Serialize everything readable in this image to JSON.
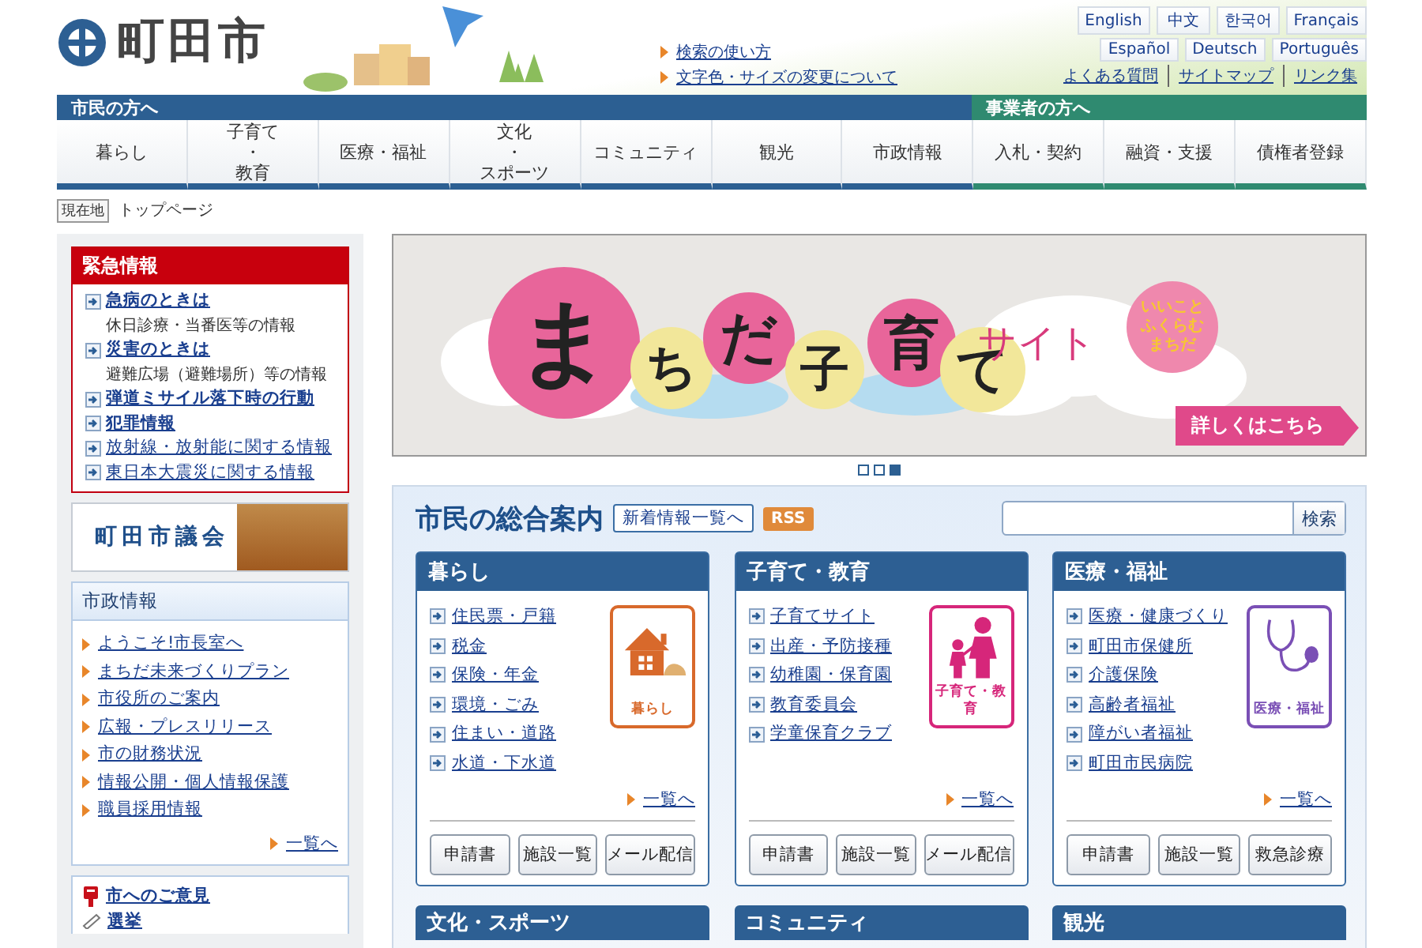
{
  "header": {
    "logo_text": "町田市",
    "help_links": [
      "検索の使い方",
      "文字色・サイズの変更について"
    ],
    "languages": [
      "English",
      "中文",
      "한국어",
      "Français",
      "Español",
      "Deutsch",
      "Português"
    ],
    "utility_links": [
      "よくある質問",
      "サイトマップ",
      "リンク集"
    ]
  },
  "nav": {
    "citizen_label": "市民の方へ",
    "business_label": "事業者の方へ",
    "items": [
      {
        "lines": [
          "暮らし"
        ],
        "kind": "citizen"
      },
      {
        "lines": [
          "子育て",
          "・",
          "教育"
        ],
        "kind": "citizen"
      },
      {
        "lines": [
          "医療・福祉"
        ],
        "kind": "citizen"
      },
      {
        "lines": [
          "文化",
          "・",
          "スポーツ"
        ],
        "kind": "citizen"
      },
      {
        "lines": [
          "コミュニティ"
        ],
        "kind": "citizen"
      },
      {
        "lines": [
          "観光"
        ],
        "kind": "citizen"
      },
      {
        "lines": [
          "市政情報"
        ],
        "kind": "citizen"
      },
      {
        "lines": [
          "入札・契約"
        ],
        "kind": "business"
      },
      {
        "lines": [
          "融資・支援"
        ],
        "kind": "business"
      },
      {
        "lines": [
          "債権者登録"
        ],
        "kind": "business"
      }
    ]
  },
  "breadcrumb": {
    "label": "現在地",
    "current": "トップページ"
  },
  "emergency": {
    "title": "緊急情報",
    "items": [
      {
        "link": "急病のときは",
        "note": "休日診療・当番医等の情報",
        "emphasized": true
      },
      {
        "link": "災害のときは",
        "note": "避難広場（避難場所）等の情報",
        "emphasized": true
      },
      {
        "link": "弾道ミサイル落下時の行動",
        "emphasized": true
      },
      {
        "link": "犯罪情報",
        "emphasized": true
      },
      {
        "link": "放射線・放射能に関する情報",
        "emphasized": false
      },
      {
        "link": "東日本大震災に関する情報",
        "emphasized": false
      }
    ]
  },
  "council": {
    "title": "町田市議会"
  },
  "city_info": {
    "title": "市政情報",
    "links": [
      "ようこそ!市長室へ",
      "まちだ未来づくりプラン",
      "市役所のご案内",
      "広報・プレスリリース",
      "市の財務状況",
      "情報公開・個人情報保護",
      "職員採用情報"
    ],
    "more": "一覧へ"
  },
  "opinion": {
    "links": [
      {
        "text": "市へのご意見",
        "kind": "postbox"
      },
      {
        "text": "選挙",
        "kind": "pencil"
      }
    ]
  },
  "banner": {
    "title_letters": [
      "ま",
      "ち",
      "だ",
      "子",
      "育",
      "て"
    ],
    "suffix": "サイト",
    "balloon": [
      "いいこと",
      "ふくらむ",
      "まちだ"
    ],
    "cta": "詳しくはこちら",
    "dots": [
      {
        "selected": false
      },
      {
        "selected": false
      },
      {
        "selected": true
      }
    ]
  },
  "guide": {
    "title": "市民の総合案内",
    "news_button": "新着情報一覧へ",
    "rss": "RSS",
    "search_button": "検索"
  },
  "cards": [
    {
      "title": "暮らし",
      "kind": "house",
      "icon_label": "暮らし",
      "color": "#d8692b",
      "links": [
        "住民票・戸籍",
        "税金",
        "保険・年金",
        "環境・ごみ",
        "住まい・道路",
        "水道・下水道"
      ],
      "more": "一覧へ",
      "buttons": [
        "申請書",
        "施設一覧",
        "メール配信"
      ]
    },
    {
      "title": "子育て・教育",
      "kind": "family",
      "icon_label": "子育て・教育",
      "color": "#d6267a",
      "links": [
        "子育てサイト",
        "出産・予防接種",
        "幼稚園・保育園",
        "教育委員会",
        "学童保育クラブ"
      ],
      "more": "一覧へ",
      "buttons": [
        "申請書",
        "施設一覧",
        "メール配信"
      ]
    },
    {
      "title": "医療・福祉",
      "kind": "stethoscope",
      "icon_label": "医療・福祉",
      "color": "#7a4fb5",
      "links": [
        "医療・健康づくり",
        "町田市保健所",
        "介護保険",
        "高齢者福祉",
        "障がい者福祉",
        "町田市民病院"
      ],
      "more": "一覧へ",
      "buttons": [
        "申請書",
        "施設一覧",
        "救急診療"
      ]
    }
  ],
  "more_cards": [
    {
      "title": "文化・スポーツ"
    },
    {
      "title": "コミュニティ"
    },
    {
      "title": "観光"
    }
  ]
}
